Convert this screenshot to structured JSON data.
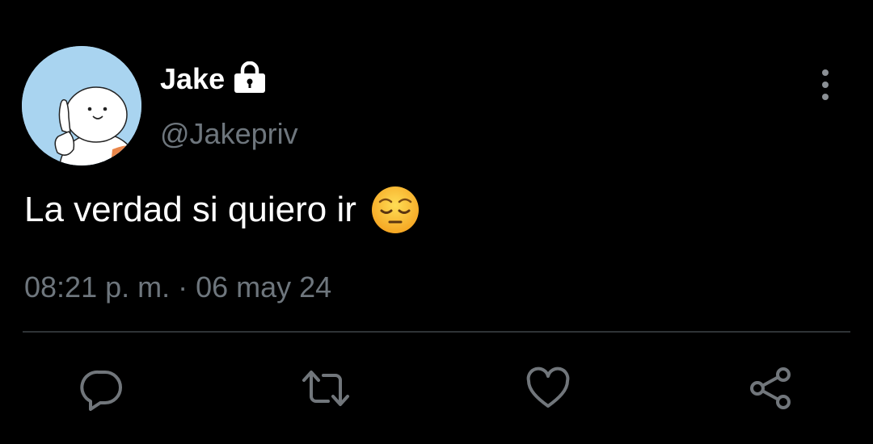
{
  "author": {
    "display_name": "Jake",
    "handle": "@Jakepriv",
    "protected_icon": "lock-icon",
    "avatar_icon": "waving-character-avatar"
  },
  "tweet": {
    "text": "La verdad si quiero ir",
    "emoji": "pensive-face-emoji",
    "timestamp": "08:21 p. m. · 06 may 24"
  },
  "actions": [
    {
      "name": "reply",
      "icon": "reply-icon"
    },
    {
      "name": "retweet",
      "icon": "retweet-icon"
    },
    {
      "name": "like",
      "icon": "heart-icon"
    },
    {
      "name": "share",
      "icon": "share-icon"
    }
  ],
  "menu_icon": "more-vertical-icon",
  "colors": {
    "background": "#000000",
    "primary_text": "#ffffff",
    "secondary_text": "#6e767d",
    "divider": "#2f3336",
    "icon": "#71767b"
  }
}
